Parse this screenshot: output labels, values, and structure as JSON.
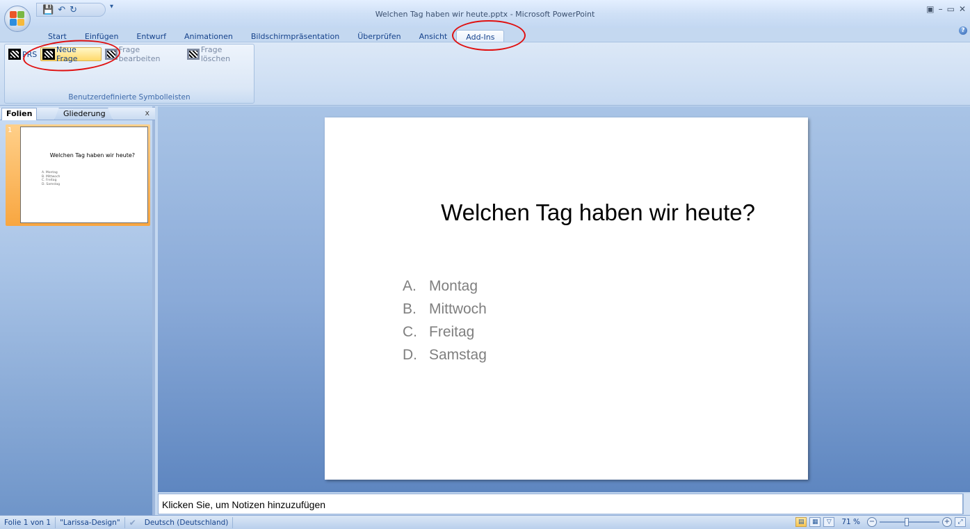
{
  "window": {
    "title": "Welchen Tag haben wir heute.pptx - Microsoft PowerPoint",
    "controls": [
      "▣",
      "–",
      "▭",
      "✕"
    ]
  },
  "qat": {
    "save_icon": "save-icon",
    "undo_icon": "undo-icon",
    "redo_icon": "redo-icon",
    "customize": "▾"
  },
  "ribbon_tabs": [
    "Start",
    "Einfügen",
    "Entwurf",
    "Animationen",
    "Bildschirmpräsentation",
    "Überprüfen",
    "Ansicht",
    "Add-Ins"
  ],
  "active_tab": "Add-Ins",
  "ribbon": {
    "group_label": "Benutzerdefinierte Symbolleisten",
    "items": [
      {
        "label": "PRS",
        "state": "normal"
      },
      {
        "label": "Neue Frage",
        "state": "highlighted"
      },
      {
        "label": "Frage bearbeiten",
        "state": "disabled"
      },
      {
        "label": "Frage löschen",
        "state": "disabled"
      }
    ]
  },
  "left_pane": {
    "tabs": [
      "Folien",
      "Gliederung"
    ],
    "close": "x",
    "slide_number": "1"
  },
  "slide": {
    "title": "Welchen Tag haben wir heute?",
    "answers": [
      {
        "letter": "A.",
        "text": "Montag"
      },
      {
        "letter": "B.",
        "text": "Mittwoch"
      },
      {
        "letter": "C.",
        "text": "Freitag"
      },
      {
        "letter": "D.",
        "text": "Samstag"
      }
    ]
  },
  "notes": {
    "placeholder": "Klicken Sie, um  Notizen hinzuzufügen"
  },
  "status": {
    "slide_info": "Folie 1 von 1",
    "theme": "\"Larissa-Design\"",
    "language": "Deutsch (Deutschland)",
    "zoom": "71 %"
  },
  "colors": {
    "annotation": "#e01010",
    "highlight": "#ffd96b",
    "accent": "#15428b"
  }
}
